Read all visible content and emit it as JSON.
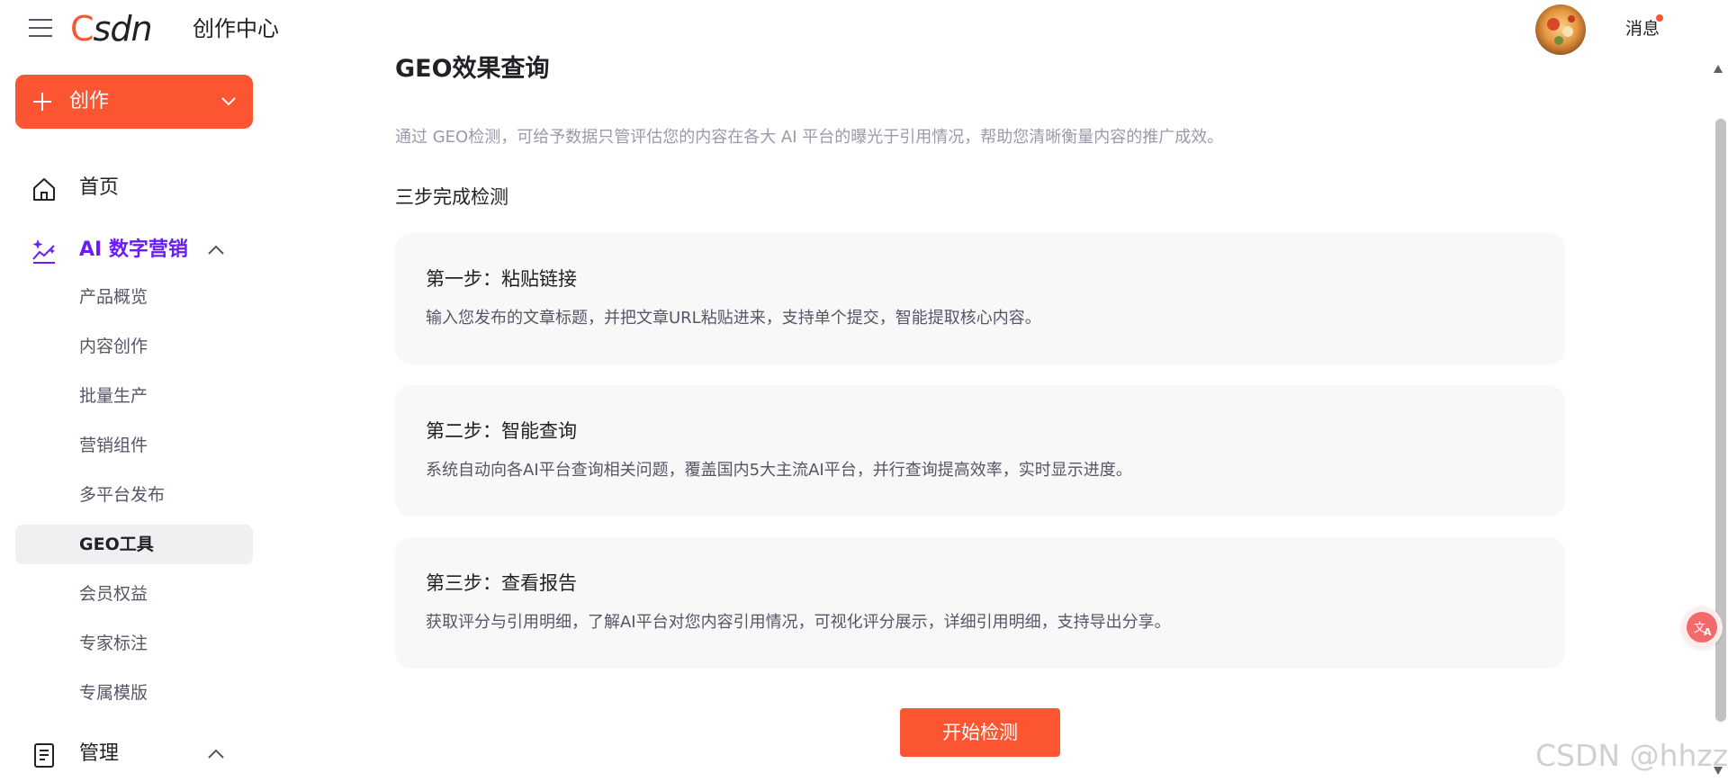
{
  "header": {
    "logo_text": "CSDN",
    "title": "创作中心",
    "messages_label": "消息"
  },
  "sidebar": {
    "create_label": "创作",
    "nav": {
      "home": "首页",
      "ai_marketing": "AI 数字营销",
      "manage": "管理"
    },
    "ai_marketing_items": [
      {
        "label": "产品概览"
      },
      {
        "label": "内容创作"
      },
      {
        "label": "批量生产"
      },
      {
        "label": "营销组件"
      },
      {
        "label": "多平台发布"
      },
      {
        "label": "GEO工具",
        "selected": true
      },
      {
        "label": "会员权益"
      },
      {
        "label": "专家标注"
      },
      {
        "label": "专属模版"
      }
    ]
  },
  "main": {
    "title": "GEO效果查询",
    "description": "通过 GEO检测，可给予数据只管评估您的内容在各大 AI 平台的曝光于引用情况，帮助您清晰衡量内容的推广成效。",
    "steps_heading": "三步完成检测",
    "steps": [
      {
        "title": "第一步：粘贴链接",
        "description": "输入您发布的文章标题，并把文章URL粘贴进来，支持单个提交，智能提取核心内容。"
      },
      {
        "title": "第二步：智能查询",
        "description": "系统自动向各AI平台查询相关问题，覆盖国内5大主流AI平台，并行查询提高效率，实时显示进度。"
      },
      {
        "title": "第三步：查看报告",
        "description": "获取评分与引用明细，了解AI平台对您内容引用情况，可视化评分展示，详细引用明细，支持导出分享。"
      }
    ],
    "start_button": "开始检测"
  },
  "watermark": "CSDN @hhzz",
  "colors": {
    "brand": "#fc5531",
    "active_nav": "#6a1bff",
    "card_bg": "#f8f8f8"
  }
}
